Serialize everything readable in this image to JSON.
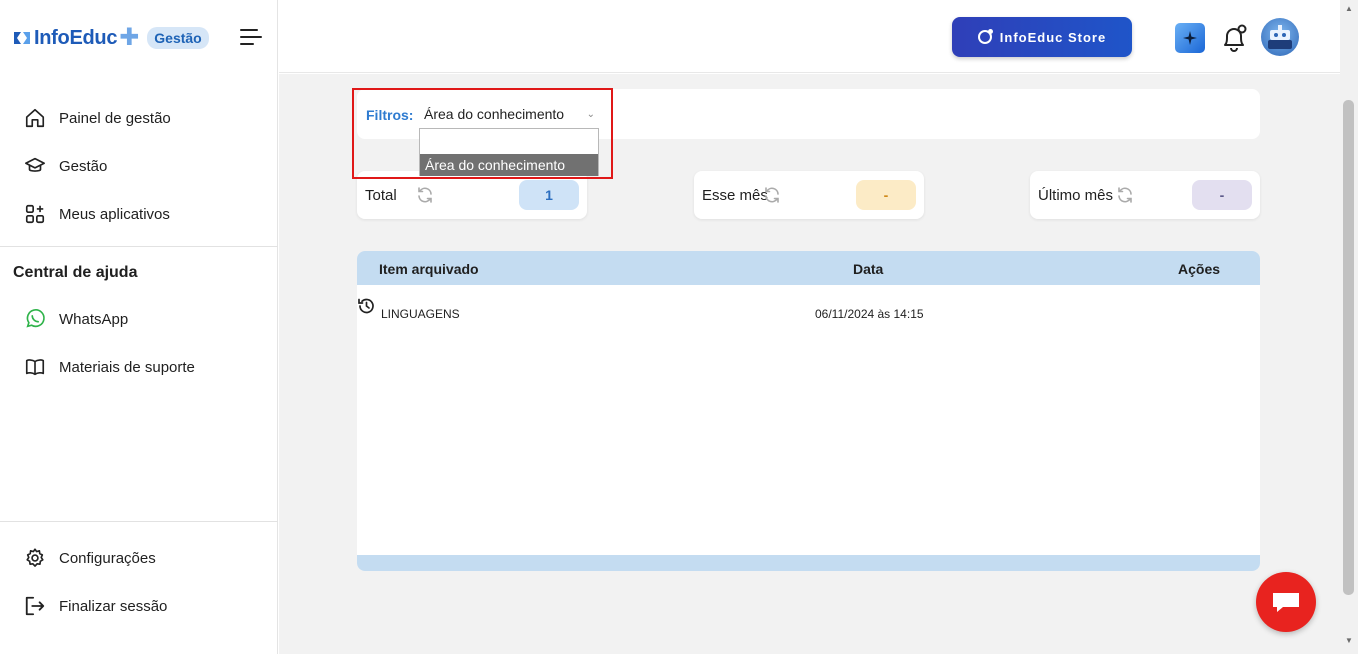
{
  "brand": {
    "name": "InfoEduc",
    "badge": "Gestão"
  },
  "sidebar": {
    "nav": [
      {
        "label": "Painel de gestão",
        "icon": "home-icon"
      },
      {
        "label": "Gestão",
        "icon": "graduation-cap-icon"
      },
      {
        "label": "Meus aplicativos",
        "icon": "apps-grid-icon"
      }
    ],
    "help_title": "Central de ajuda",
    "help": [
      {
        "label": "WhatsApp",
        "icon": "whatsapp-icon"
      },
      {
        "label": "Materiais de suporte",
        "icon": "book-open-icon"
      }
    ],
    "footer": [
      {
        "label": "Configurações",
        "icon": "gear-icon"
      },
      {
        "label": "Finalizar sessão",
        "icon": "logout-icon"
      }
    ]
  },
  "topbar": {
    "store_label": "InfoEduc Store"
  },
  "filter": {
    "label": "Filtros:",
    "selected": "Área do conhecimento",
    "options": [
      "",
      "Área do conhecimento"
    ]
  },
  "stats": [
    {
      "label": "Total",
      "value": "1",
      "color": "#cfe3f7",
      "text_color": "#2c6fc0"
    },
    {
      "label": "Esse mês",
      "value": "-",
      "color": "#fcebc6",
      "text_color": "#d08a1a"
    },
    {
      "label": "Último mês",
      "value": "-",
      "color": "#e3dff0",
      "text_color": "#5d5a8a"
    }
  ],
  "table": {
    "headers": [
      "Item arquivado",
      "Data",
      "Ações"
    ],
    "rows": [
      {
        "item": "LINGUAGENS",
        "date": "06/11/2024 às 14:15",
        "action_icon": "restore-history-icon"
      }
    ]
  },
  "colors": {
    "accent": "#2e7bd0",
    "header_bg": "#c4dcf1",
    "chat": "#e8231f",
    "highlight": "#e01818"
  }
}
